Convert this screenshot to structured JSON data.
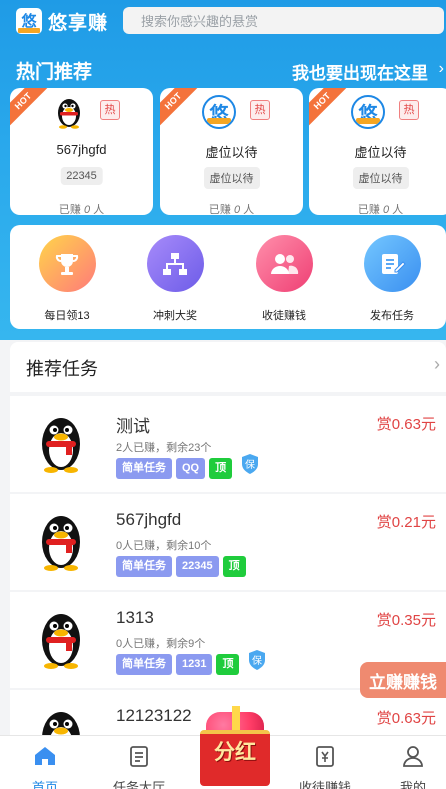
{
  "app": {
    "name": "悠享赚",
    "logo_glyph": "悠"
  },
  "search": {
    "placeholder": "搜索你感兴趣的悬赏"
  },
  "hot": {
    "title": "热门推荐",
    "cta": "我也要出现在这里",
    "chevron": "›",
    "cards": [
      {
        "ribbon": "HOT",
        "tag": "热",
        "avatar": "qq-penguin",
        "name": "567jhgfd",
        "chip": "22345",
        "earned_prefix": "已赚 ",
        "earned_count": "0",
        "earned_suffix": " 人"
      },
      {
        "ribbon": "HOT",
        "tag": "热",
        "avatar": "app-logo",
        "name": "虚位以待",
        "chip": "虚位以待",
        "earned_prefix": "已赚 ",
        "earned_count": "0",
        "earned_suffix": " 人"
      },
      {
        "ribbon": "HOT",
        "tag": "热",
        "avatar": "app-logo",
        "name": "虚位以待",
        "chip": "虚位以待",
        "earned_prefix": "已赚 ",
        "earned_count": "0",
        "earned_suffix": " 人"
      }
    ]
  },
  "quick": [
    {
      "label": "每日领13",
      "icon": "trophy-icon"
    },
    {
      "label": "冲刺大奖",
      "icon": "hierarchy-icon"
    },
    {
      "label": "收徒赚钱",
      "icon": "users-icon"
    },
    {
      "label": "发布任务",
      "icon": "edit-icon"
    }
  ],
  "recommend": {
    "title": "推荐任务",
    "chevron": "›",
    "tasks": [
      {
        "name": "测试",
        "sub": "2人已赚，剩余23个",
        "tags": [
          "简单任务",
          "QQ"
        ],
        "top": "顶",
        "guarantee": "保",
        "reward": "赏0.63元"
      },
      {
        "name": "567jhgfd",
        "sub": "0人已赚，剩余10个",
        "tags": [
          "简单任务",
          "22345"
        ],
        "top": "顶",
        "guarantee": "",
        "reward": "赏0.21元"
      },
      {
        "name": "1313",
        "sub": "0人已赚，剩余9个",
        "tags": [
          "简单任务",
          "1231"
        ],
        "top": "顶",
        "guarantee": "保",
        "reward": "赏0.35元"
      },
      {
        "name": "12123122",
        "sub": "",
        "tags": [],
        "top": "",
        "guarantee": "",
        "reward": "赏0.63元"
      }
    ]
  },
  "float_button": "立赚赚钱",
  "redpacket_text": "分红",
  "tabs": [
    {
      "label": "首页",
      "icon": "home-icon",
      "active": true
    },
    {
      "label": "任务大厅",
      "icon": "list-icon",
      "active": false
    },
    {
      "label": "收徒赚钱",
      "icon": "wallet-icon",
      "active": false
    },
    {
      "label": "我的",
      "icon": "user-icon",
      "active": false
    }
  ],
  "colors": {
    "primary": "#1e88e5",
    "hero": "#2aa9ec",
    "reward": "#e04444",
    "tag_purple": "#8b9af0",
    "tag_green": "#1fcc3c",
    "hot_ribbon": "#f4733b"
  }
}
